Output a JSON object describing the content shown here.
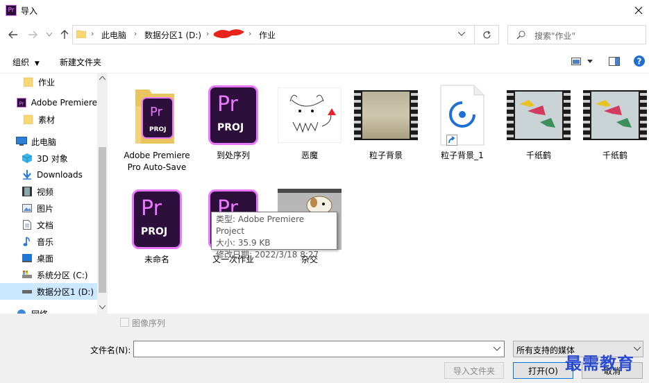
{
  "window": {
    "title": "导入",
    "app_icon_text": "Pr"
  },
  "nav": {
    "breadcrumbs": [
      "此电脑",
      "数据分区1 (D:)",
      "作业"
    ],
    "search_placeholder": "搜索\"作业\""
  },
  "toolbar": {
    "organize": "组织",
    "new_folder": "新建文件夹"
  },
  "sidebar": {
    "items": [
      {
        "label": "作业",
        "icon": "folder-icon"
      },
      {
        "label": "Adobe Premiere",
        "icon": "premiere-icon"
      },
      {
        "label": "素材",
        "icon": "folder-icon"
      },
      {
        "label": "此电脑",
        "icon": "computer-icon"
      },
      {
        "label": "3D 对象",
        "icon": "cube-icon"
      },
      {
        "label": "Downloads",
        "icon": "download-icon"
      },
      {
        "label": "视频",
        "icon": "video-icon"
      },
      {
        "label": "图片",
        "icon": "picture-icon"
      },
      {
        "label": "文档",
        "icon": "document-icon"
      },
      {
        "label": "音乐",
        "icon": "music-icon"
      },
      {
        "label": "桌面",
        "icon": "desktop-icon"
      },
      {
        "label": "系统分区 (C:)",
        "icon": "drive-icon"
      },
      {
        "label": "数据分区1 (D:)",
        "icon": "drive-icon"
      },
      {
        "label": "网络",
        "icon": "network-icon"
      }
    ]
  },
  "files": [
    {
      "label": "Adobe Premiere Pro Auto-Save",
      "type": "folder-pr"
    },
    {
      "label": "到处序列",
      "type": "prproj"
    },
    {
      "label": "恶魔",
      "type": "image-devil"
    },
    {
      "label": "粒子背景",
      "type": "video"
    },
    {
      "label": "粒子背景_1",
      "type": "shortcut-media"
    },
    {
      "label": "千纸鹤",
      "type": "video-crane"
    },
    {
      "label": "千纸鹤",
      "type": "video-crane"
    },
    {
      "label": "未命名",
      "type": "prproj"
    },
    {
      "label": "又一次作业",
      "type": "prproj"
    },
    {
      "label": "杂交",
      "type": "image-dog"
    }
  ],
  "pr_tile": {
    "big": "Pr",
    "small": "PROJ"
  },
  "tooltip": {
    "line1": "类型: Adobe Premiere Project",
    "line2": "大小: 35.9 KB",
    "line3": "修改日期: 2022/3/18 8:27"
  },
  "bottom": {
    "image_sequence": "图像序列",
    "filename_label": "文件名(N):",
    "filename_value": "",
    "filter": "所有支持的媒体",
    "import_folder": "导入文件夹",
    "open": "打开(O)",
    "cancel": "取消"
  },
  "watermark": "最需教育",
  "colors": {
    "pr_purple": "#ea77ff",
    "pr_bg": "#2c0f3a",
    "selection": "#cce8ff",
    "watermark": "#1b3fd1"
  }
}
